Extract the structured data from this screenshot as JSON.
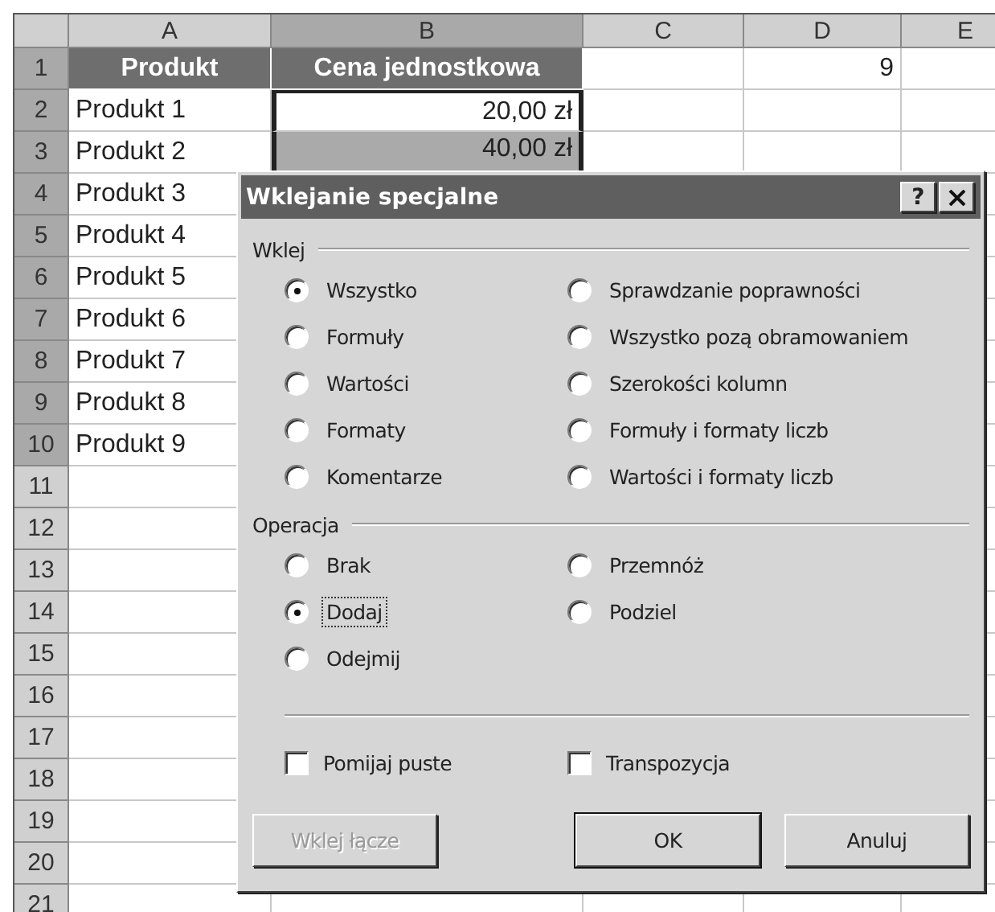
{
  "sheet": {
    "columns": [
      {
        "label": "A",
        "selected": false
      },
      {
        "label": "B",
        "selected": true
      },
      {
        "label": "C",
        "selected": false
      },
      {
        "label": "D",
        "selected": false
      },
      {
        "label": "E",
        "selected": false
      }
    ],
    "rows": [
      {
        "number": "1",
        "selected": true,
        "cells": [
          {
            "kind": "header",
            "text": "Produkt"
          },
          {
            "kind": "header",
            "text": "Cena jednostkowa"
          },
          {},
          {
            "kind": "number",
            "text": "9"
          },
          {}
        ]
      },
      {
        "number": "2",
        "selected": true,
        "cells": [
          {
            "kind": "text",
            "text": "Produkt 1"
          },
          {
            "kind": "marquee",
            "text": "20,00 zł"
          },
          {},
          {},
          {}
        ]
      },
      {
        "number": "3",
        "selected": true,
        "cells": [
          {
            "kind": "text",
            "text": "Produkt 2"
          },
          {
            "kind": "marquee_shaded",
            "text": "40,00 zł"
          },
          {},
          {},
          {}
        ]
      },
      {
        "number": "4",
        "selected": true,
        "cells": [
          {
            "kind": "text",
            "text": "Produkt 3"
          }
        ]
      },
      {
        "number": "5",
        "selected": true,
        "cells": [
          {
            "kind": "text",
            "text": "Produkt 4"
          }
        ]
      },
      {
        "number": "6",
        "selected": true,
        "cells": [
          {
            "kind": "text",
            "text": "Produkt 5"
          }
        ]
      },
      {
        "number": "7",
        "selected": true,
        "cells": [
          {
            "kind": "text",
            "text": "Produkt 6"
          }
        ]
      },
      {
        "number": "8",
        "selected": true,
        "cells": [
          {
            "kind": "text",
            "text": "Produkt 7"
          }
        ]
      },
      {
        "number": "9",
        "selected": true,
        "cells": [
          {
            "kind": "text",
            "text": "Produkt 8"
          }
        ]
      },
      {
        "number": "10",
        "selected": true,
        "cells": [
          {
            "kind": "text",
            "text": "Produkt 9"
          }
        ]
      },
      {
        "number": "11",
        "selected": false
      },
      {
        "number": "12",
        "selected": false
      },
      {
        "number": "13",
        "selected": false
      },
      {
        "number": "14",
        "selected": false
      },
      {
        "number": "15",
        "selected": false
      },
      {
        "number": "16",
        "selected": false
      },
      {
        "number": "17",
        "selected": false
      },
      {
        "number": "18",
        "selected": false
      },
      {
        "number": "19",
        "selected": false
      },
      {
        "number": "20",
        "selected": false
      },
      {
        "number": "21",
        "selected": false
      }
    ]
  },
  "dialog": {
    "title": "Wklejanie specjalne",
    "help_button": "?",
    "paste_group": {
      "label": "Wklej",
      "options": [
        {
          "label": "Wszystko",
          "selected": true,
          "focused": false
        },
        {
          "label": "Sprawdzanie poprawności",
          "selected": false,
          "focused": false
        },
        {
          "label": "Formuły",
          "selected": false,
          "focused": false
        },
        {
          "label": "Wszystko pozą obramowaniem",
          "selected": false,
          "focused": false
        },
        {
          "label": "Wartości",
          "selected": false,
          "focused": false
        },
        {
          "label": "Szerokości kolumn",
          "selected": false,
          "focused": false
        },
        {
          "label": "Formaty",
          "selected": false,
          "focused": false
        },
        {
          "label": "Formuły i formaty liczb",
          "selected": false,
          "focused": false
        },
        {
          "label": "Komentarze",
          "selected": false,
          "focused": false
        },
        {
          "label": "Wartości i formaty liczb",
          "selected": false,
          "focused": false
        }
      ]
    },
    "operation_group": {
      "label": "Operacja",
      "options": [
        {
          "label": "Brak",
          "selected": false,
          "focused": false
        },
        {
          "label": "Przemnóż",
          "selected": false,
          "focused": false
        },
        {
          "label": "Dodaj",
          "selected": true,
          "focused": true
        },
        {
          "label": "Podziel",
          "selected": false,
          "focused": false
        },
        {
          "label": "Odejmij",
          "selected": false,
          "focused": false
        }
      ]
    },
    "checkboxes": [
      {
        "label": "Pomijaj puste",
        "checked": false
      },
      {
        "label": "Transpozycja",
        "checked": false
      }
    ],
    "buttons": [
      {
        "label": "Wklej łącze",
        "disabled": true,
        "default": false
      },
      {
        "label": "OK",
        "disabled": false,
        "default": true
      },
      {
        "label": "Anuluj",
        "disabled": false,
        "default": false
      }
    ]
  }
}
